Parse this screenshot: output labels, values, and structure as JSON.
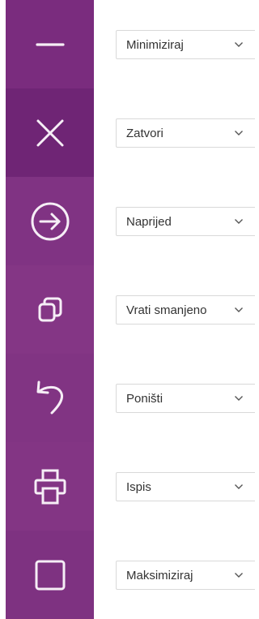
{
  "colors": {
    "tile_background": "#7e2f82",
    "tile_background_alt": "#74287a",
    "icon_stroke": "#f6eef6",
    "select_border": "#d9d9d9",
    "select_text": "#333333"
  },
  "rows": [
    {
      "icon": "minimize-icon",
      "label": "Minimiziraj"
    },
    {
      "icon": "close-icon",
      "label": "Zatvori"
    },
    {
      "icon": "forward-arrow-icon",
      "label": "Naprijed"
    },
    {
      "icon": "restore-down-icon",
      "label": "Vrati smanjeno"
    },
    {
      "icon": "undo-icon",
      "label": "Poništi"
    },
    {
      "icon": "print-icon",
      "label": "Ispis"
    },
    {
      "icon": "maximize-icon",
      "label": "Maksimiziraj"
    }
  ]
}
